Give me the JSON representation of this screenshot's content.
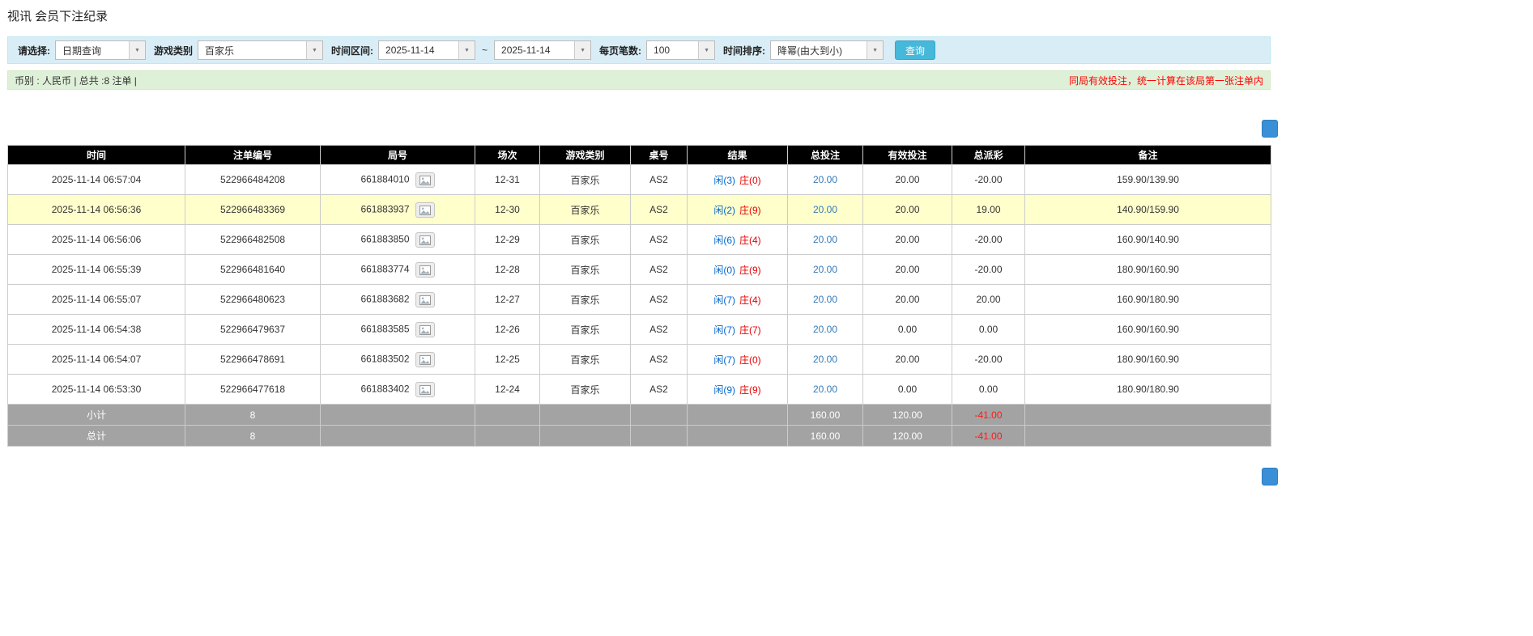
{
  "page": {
    "title": "视讯 会员下注纪录"
  },
  "filters": {
    "select_label": "请选择:",
    "select_value": "日期查询",
    "game_type_label": "游戏类别",
    "game_type_value": "百家乐",
    "date_range_label": "时间区间:",
    "date_from": "2025-11-14",
    "tilde": "~",
    "date_to": "2025-11-14",
    "page_size_label": "每页笔数:",
    "page_size_value": "100",
    "sort_label": "时间排序:",
    "sort_value": "降幂(由大到小)",
    "search_button": "查询"
  },
  "summary": {
    "left": "币别 : 人民币 | 总共 :8 注单 |",
    "right": "同局有效投注，统一计算在该局第一张注单内"
  },
  "table": {
    "headers": [
      "时间",
      "注单编号",
      "局号",
      "场次",
      "游戏类别",
      "桌号",
      "结果",
      "总投注",
      "有效投注",
      "总派彩",
      "备注"
    ],
    "rows": [
      {
        "time": "2025-11-14 06:57:04",
        "bet_id": "522966484208",
        "round": "661884010",
        "session": "12-31",
        "game": "百家乐",
        "table_no": "AS2",
        "result_player": "闲(3)",
        "result_banker": "庄(0)",
        "total_bet": "20.00",
        "valid_bet": "20.00",
        "payout": "-20.00",
        "note": "159.90/139.90",
        "highlight": false
      },
      {
        "time": "2025-11-14 06:56:36",
        "bet_id": "522966483369",
        "round": "661883937",
        "session": "12-30",
        "game": "百家乐",
        "table_no": "AS2",
        "result_player": "闲(2)",
        "result_banker": "庄(9)",
        "total_bet": "20.00",
        "valid_bet": "20.00",
        "payout": "19.00",
        "note": "140.90/159.90",
        "highlight": true
      },
      {
        "time": "2025-11-14 06:56:06",
        "bet_id": "522966482508",
        "round": "661883850",
        "session": "12-29",
        "game": "百家乐",
        "table_no": "AS2",
        "result_player": "闲(6)",
        "result_banker": "庄(4)",
        "total_bet": "20.00",
        "valid_bet": "20.00",
        "payout": "-20.00",
        "note": "160.90/140.90",
        "highlight": false
      },
      {
        "time": "2025-11-14 06:55:39",
        "bet_id": "522966481640",
        "round": "661883774",
        "session": "12-28",
        "game": "百家乐",
        "table_no": "AS2",
        "result_player": "闲(0)",
        "result_banker": "庄(9)",
        "total_bet": "20.00",
        "valid_bet": "20.00",
        "payout": "-20.00",
        "note": "180.90/160.90",
        "highlight": false
      },
      {
        "time": "2025-11-14 06:55:07",
        "bet_id": "522966480623",
        "round": "661883682",
        "session": "12-27",
        "game": "百家乐",
        "table_no": "AS2",
        "result_player": "闲(7)",
        "result_banker": "庄(4)",
        "total_bet": "20.00",
        "valid_bet": "20.00",
        "payout": "20.00",
        "note": "160.90/180.90",
        "highlight": false
      },
      {
        "time": "2025-11-14 06:54:38",
        "bet_id": "522966479637",
        "round": "661883585",
        "session": "12-26",
        "game": "百家乐",
        "table_no": "AS2",
        "result_player": "闲(7)",
        "result_banker": "庄(7)",
        "total_bet": "20.00",
        "valid_bet": "0.00",
        "payout": "0.00",
        "note": "160.90/160.90",
        "highlight": false
      },
      {
        "time": "2025-11-14 06:54:07",
        "bet_id": "522966478691",
        "round": "661883502",
        "session": "12-25",
        "game": "百家乐",
        "table_no": "AS2",
        "result_player": "闲(7)",
        "result_banker": "庄(0)",
        "total_bet": "20.00",
        "valid_bet": "20.00",
        "payout": "-20.00",
        "note": "180.90/160.90",
        "highlight": false
      },
      {
        "time": "2025-11-14 06:53:30",
        "bet_id": "522966477618",
        "round": "661883402",
        "session": "12-24",
        "game": "百家乐",
        "table_no": "AS2",
        "result_player": "闲(9)",
        "result_banker": "庄(9)",
        "total_bet": "20.00",
        "valid_bet": "0.00",
        "payout": "0.00",
        "note": "180.90/180.90",
        "highlight": false
      }
    ],
    "subtotal": {
      "label": "小计",
      "count": "8",
      "total_bet": "160.00",
      "valid_bet": "120.00",
      "payout": "-41.00"
    },
    "total": {
      "label": "总计",
      "count": "8",
      "total_bet": "160.00",
      "valid_bet": "120.00",
      "payout": "-41.00"
    }
  }
}
